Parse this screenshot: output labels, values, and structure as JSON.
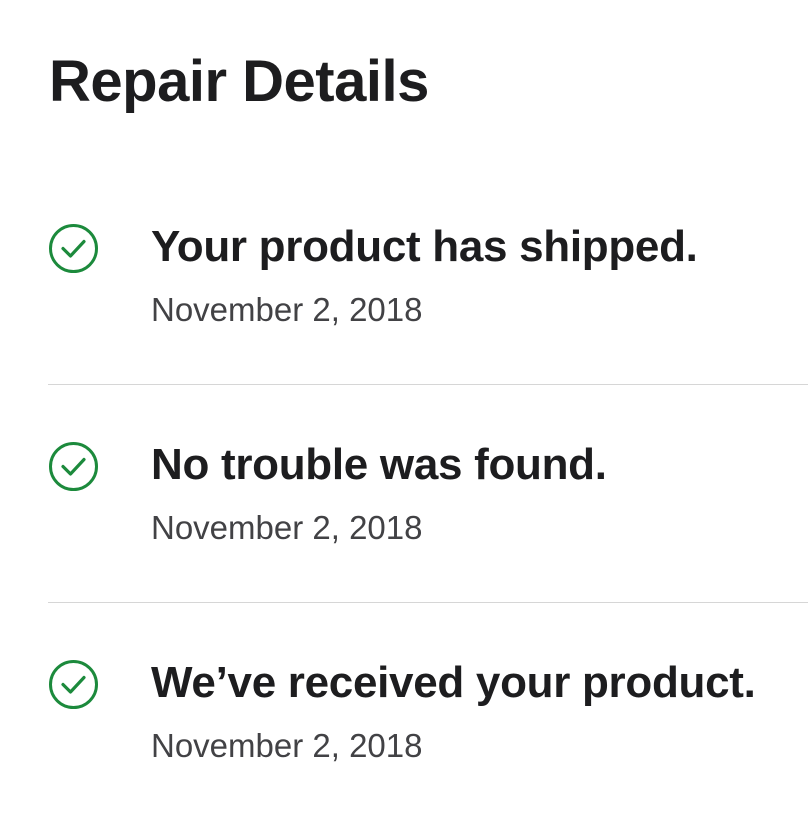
{
  "page": {
    "title": "Repair Details"
  },
  "colors": {
    "check": "#1c8a3c",
    "divider": "#d6d6d6",
    "text": "#1d1d1f",
    "secondary_text": "#424245"
  },
  "timeline": {
    "items": [
      {
        "icon": "check-circle-icon",
        "status": "Your product has shipped.",
        "date": "November 2, 2018"
      },
      {
        "icon": "check-circle-icon",
        "status": "No trouble was found.",
        "date": "November 2, 2018"
      },
      {
        "icon": "check-circle-icon",
        "status": "We’ve received your product.",
        "date": "November 2, 2018"
      }
    ]
  }
}
